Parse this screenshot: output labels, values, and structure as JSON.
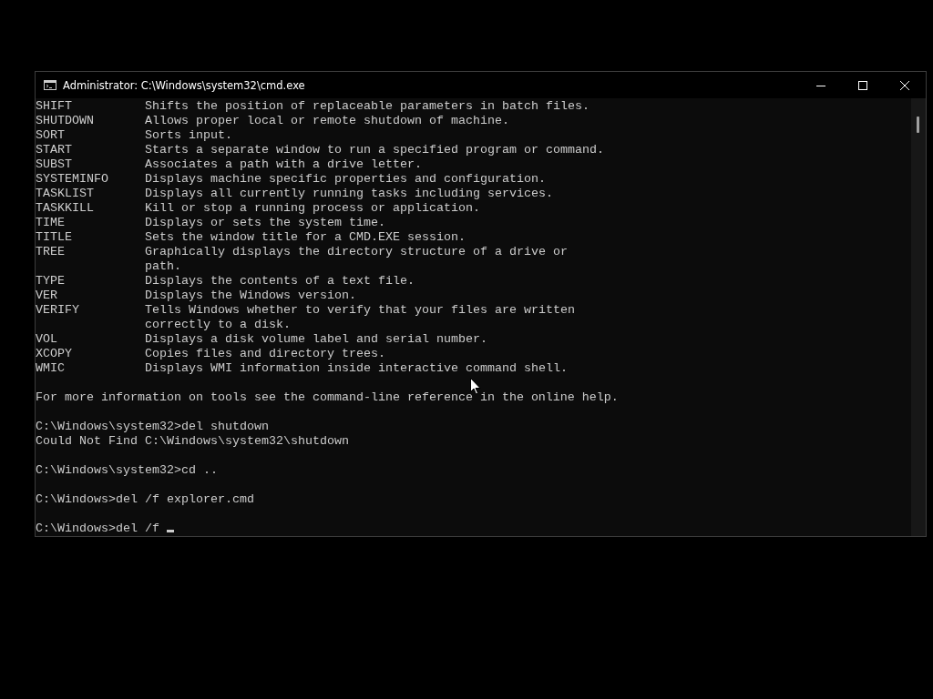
{
  "window": {
    "title": "Administrator: C:\\Windows\\system32\\cmd.exe"
  },
  "help_entries": [
    {
      "command": "SHIFT",
      "description": [
        "Shifts the position of replaceable parameters in batch files."
      ]
    },
    {
      "command": "SHUTDOWN",
      "description": [
        "Allows proper local or remote shutdown of machine."
      ]
    },
    {
      "command": "SORT",
      "description": [
        "Sorts input."
      ]
    },
    {
      "command": "START",
      "description": [
        "Starts a separate window to run a specified program or command."
      ]
    },
    {
      "command": "SUBST",
      "description": [
        "Associates a path with a drive letter."
      ]
    },
    {
      "command": "SYSTEMINFO",
      "description": [
        "Displays machine specific properties and configuration."
      ]
    },
    {
      "command": "TASKLIST",
      "description": [
        "Displays all currently running tasks including services."
      ]
    },
    {
      "command": "TASKKILL",
      "description": [
        "Kill or stop a running process or application."
      ]
    },
    {
      "command": "TIME",
      "description": [
        "Displays or sets the system time."
      ]
    },
    {
      "command": "TITLE",
      "description": [
        "Sets the window title for a CMD.EXE session."
      ]
    },
    {
      "command": "TREE",
      "description": [
        "Graphically displays the directory structure of a drive or",
        "path."
      ]
    },
    {
      "command": "TYPE",
      "description": [
        "Displays the contents of a text file."
      ]
    },
    {
      "command": "VER",
      "description": [
        "Displays the Windows version."
      ]
    },
    {
      "command": "VERIFY",
      "description": [
        "Tells Windows whether to verify that your files are written",
        "correctly to a disk."
      ]
    },
    {
      "command": "VOL",
      "description": [
        "Displays a disk volume label and serial number."
      ]
    },
    {
      "command": "XCOPY",
      "description": [
        "Copies files and directory trees."
      ]
    },
    {
      "command": "WMIC",
      "description": [
        "Displays WMI information inside interactive command shell."
      ]
    }
  ],
  "footer_note": "For more information on tools see the command-line reference in the online help.",
  "session": [
    {
      "prompt": "C:\\Windows\\system32>",
      "input": "del shutdown",
      "output": [
        "Could Not Find C:\\Windows\\system32\\shutdown"
      ],
      "cursor": false
    },
    {
      "prompt": "C:\\Windows\\system32>",
      "input": "cd ..",
      "cursor": false
    },
    {
      "prompt": "C:\\Windows>",
      "input": "del /f explorer.cmd",
      "cursor": false
    },
    {
      "prompt": "C:\\Windows>",
      "input": "del /f ",
      "cursor": true
    }
  ]
}
